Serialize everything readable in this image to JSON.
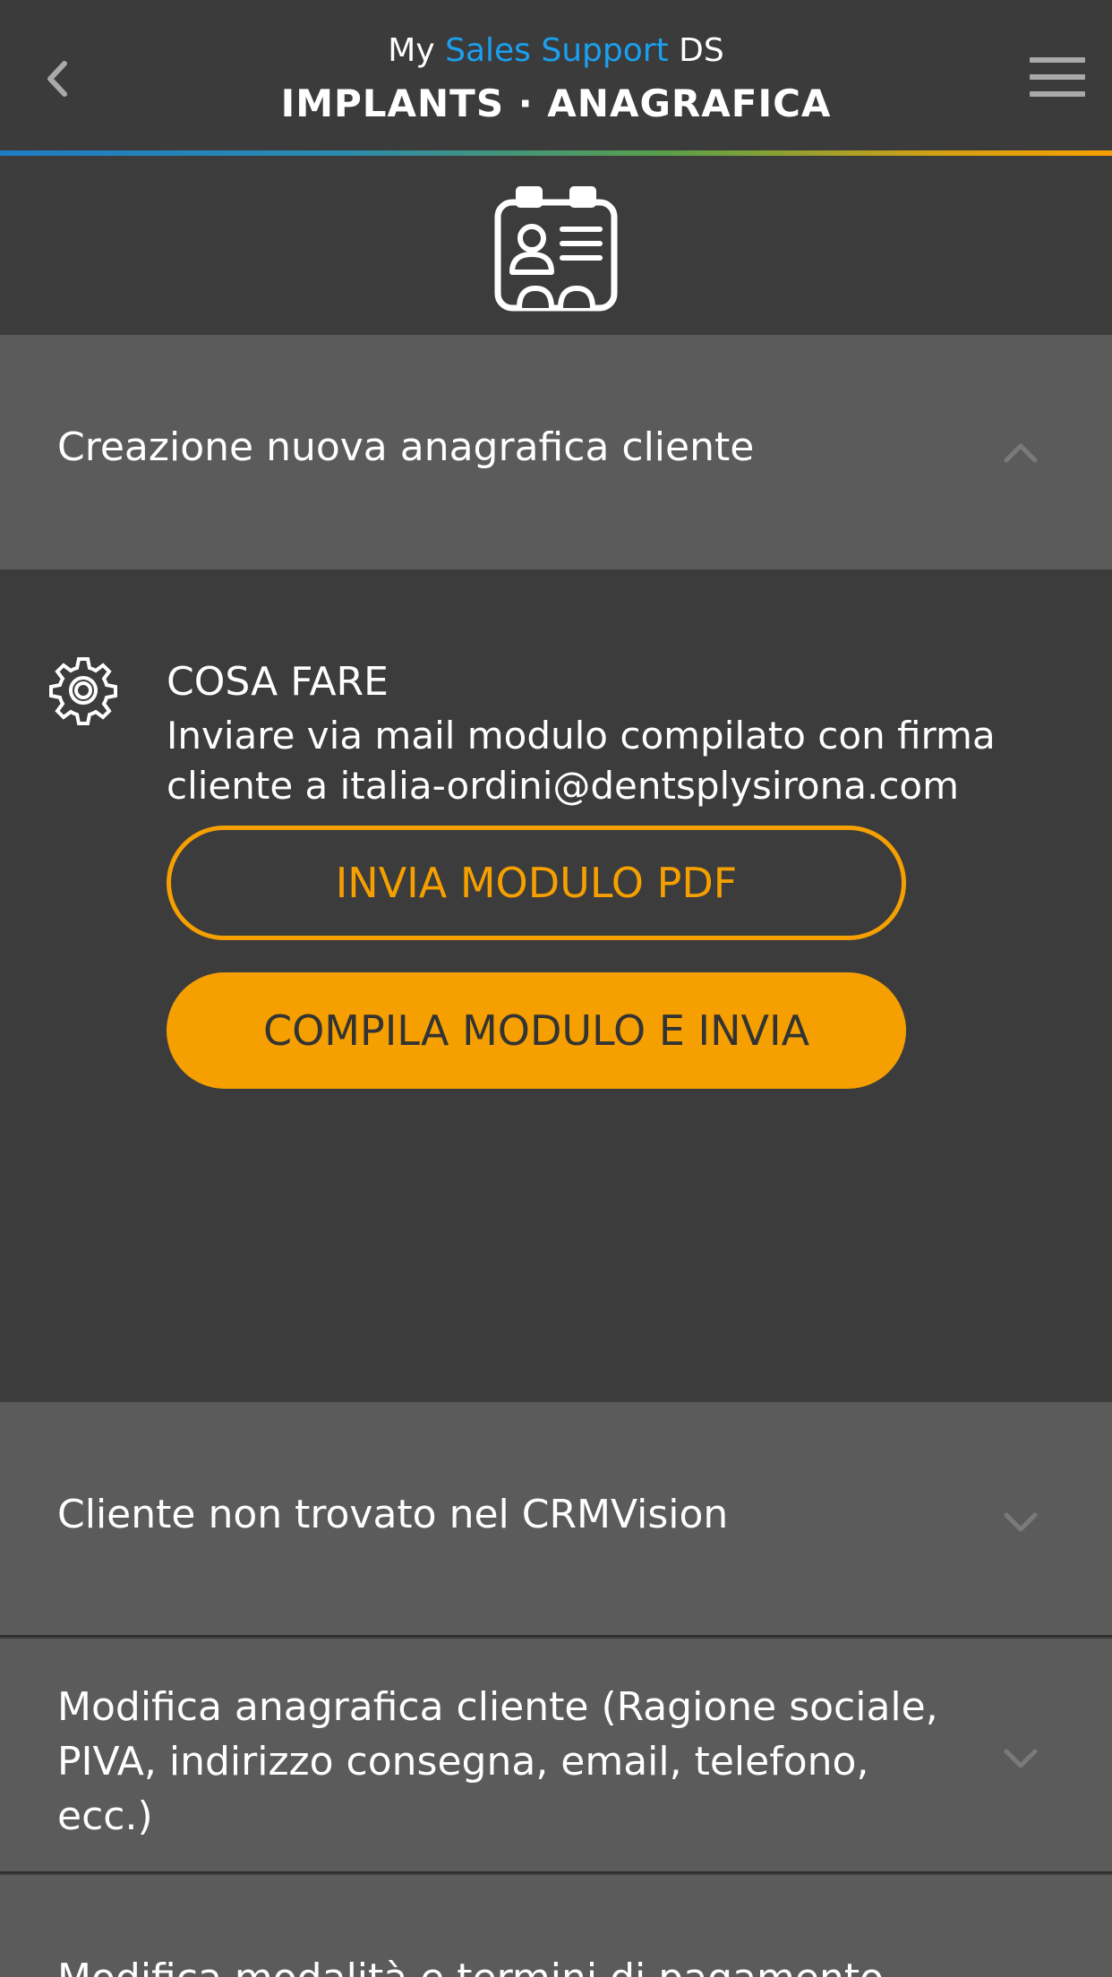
{
  "header": {
    "brand_prefix": "My",
    "brand_accent": "Sales Support",
    "brand_suffix": "DS",
    "title": "IMPLANTS · ANAGRAFICA",
    "accent_color": "#1aa0f0"
  },
  "icons": {
    "back": "chevron-left-icon",
    "menu": "hamburger-menu-icon",
    "section": "id-card-icon",
    "gear": "gear-icon"
  },
  "accordion": [
    {
      "label": "Creazione nuova anagrafica cliente",
      "expanded": true
    },
    {
      "label": "Cliente non trovato nel CRMVision",
      "expanded": false
    },
    {
      "label": "Modifica anagrafica cliente (Ragione sociale, PIVA, indirizzo consegna, email, telefono, ecc.)",
      "expanded": false
    },
    {
      "label": "Modifica modalità e termini di pagamento",
      "expanded": false
    }
  ],
  "content": {
    "cosa_fare_title": "COSA FARE",
    "cosa_fare_text": "Inviare via mail modulo compilato con firma cliente a italia-ordini@dentsplysirona.com",
    "button_outline": "INVIA MODULO PDF",
    "button_fill": "COMPILA MODULO E INVIA",
    "button_color": "#f5a000"
  }
}
